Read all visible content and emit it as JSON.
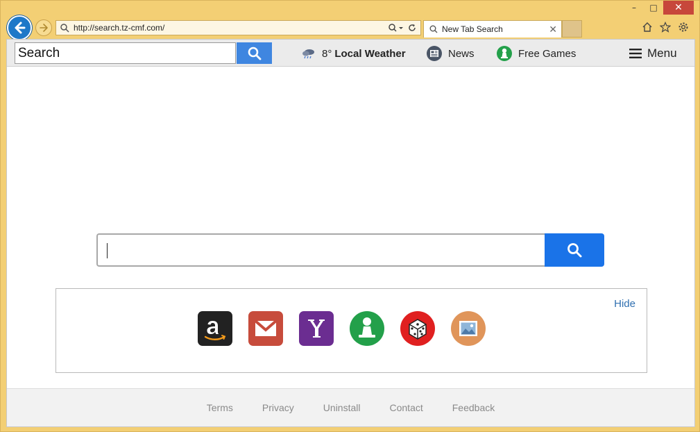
{
  "window": {
    "caption": {
      "minimize": "–",
      "maximize": "□",
      "close": "✕"
    }
  },
  "nav": {
    "url": "http://search.tz-cmf.com/",
    "tab_title": "New Tab Search"
  },
  "toolbar": {
    "search_value": "Search",
    "weather_temp": "8°",
    "weather_label": "Local Weather",
    "news_label": "News",
    "games_label": "Free Games",
    "menu_label": "Menu"
  },
  "shortcuts": {
    "hide_label": "Hide",
    "tiles": [
      "amazon",
      "gmail",
      "yahoo",
      "games",
      "dice",
      "images"
    ]
  },
  "footer": {
    "links": [
      "Terms",
      "Privacy",
      "Uninstall",
      "Contact",
      "Feedback"
    ]
  },
  "colors": {
    "frame": "#f3cf74",
    "accent_blue": "#1a73e8",
    "toolbar_blue": "#3f86e0",
    "amazon": "#222222",
    "gmail": "#c74c3c",
    "yahoo": "#6b2d91",
    "games": "#23a04a",
    "dice": "#e02020",
    "images": "#e0955a"
  }
}
